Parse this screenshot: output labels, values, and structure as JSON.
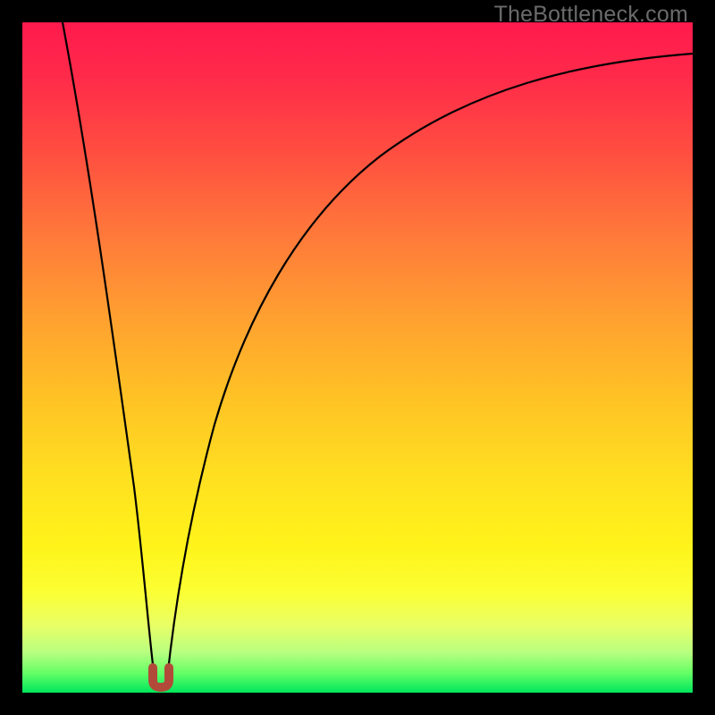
{
  "watermark": "TheBottleneck.com",
  "chart_data": {
    "type": "line",
    "title": "",
    "xlabel": "",
    "ylabel": "",
    "xlim": [
      0,
      100
    ],
    "ylim": [
      0,
      100
    ],
    "grid": false,
    "legend": false,
    "series": [
      {
        "name": "left-branch",
        "x": [
          6,
          8,
          10,
          12,
          14,
          16,
          17.5,
          18.5,
          19
        ],
        "y": [
          100,
          85,
          70,
          55,
          40,
          22,
          10,
          3,
          0
        ]
      },
      {
        "name": "right-branch",
        "x": [
          21,
          22,
          24,
          27,
          31,
          36,
          43,
          52,
          63,
          76,
          90,
          100
        ],
        "y": [
          0,
          3,
          10,
          22,
          36,
          50,
          63,
          74,
          83,
          89,
          93,
          95
        ]
      }
    ],
    "annotations": [
      {
        "name": "min-marker",
        "shape": "u",
        "x": 20,
        "y": 1
      }
    ],
    "background_gradient": {
      "top": "#ff1a4d",
      "bottom": "#00e65c"
    }
  }
}
